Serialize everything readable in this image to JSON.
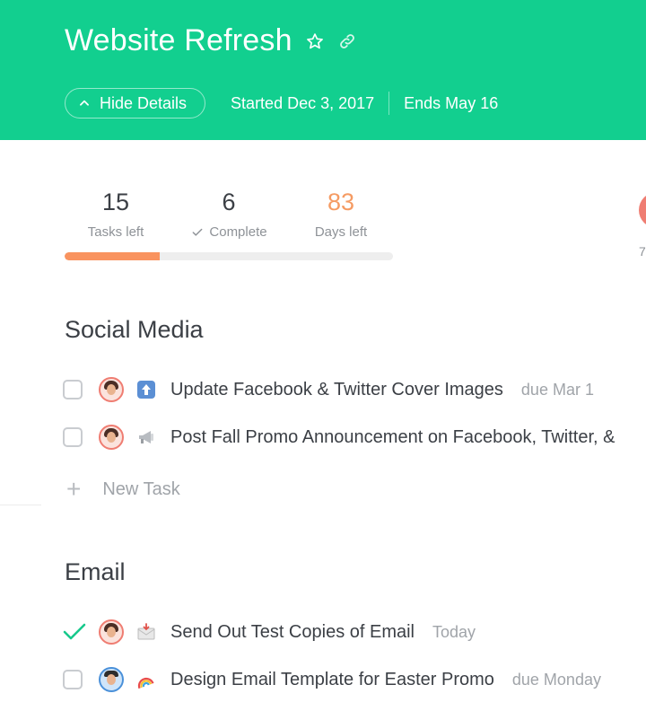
{
  "header": {
    "title": "Website Refresh",
    "hide_details_label": "Hide Details",
    "started": "Started Dec 3, 2017",
    "ends": "Ends May 16",
    "bg_color": "#12cf8f"
  },
  "stats": {
    "tasks_left": {
      "value": "15",
      "label": "Tasks left"
    },
    "complete": {
      "value": "6",
      "label": "Complete"
    },
    "days_left": {
      "value": "83",
      "label": "Days left"
    },
    "progress_fraction": 0.29,
    "progress_color": "#f9935f"
  },
  "right_partial": {
    "number": "7"
  },
  "sections": [
    {
      "title": "Social Media",
      "tasks": [
        {
          "text": "Update Facebook & Twitter Cover Images",
          "due": "due Mar 1",
          "done": false,
          "emoji": "up-arrow-icon"
        },
        {
          "text": "Post Fall Promo Announcement on Facebook, Twitter, &",
          "due": "",
          "done": false,
          "emoji": "megaphone-icon"
        }
      ],
      "new_task_label": "New Task"
    },
    {
      "title": "Email",
      "tasks": [
        {
          "text": "Send Out Test Copies of Email",
          "due": "Today",
          "done": true,
          "emoji": "envelope-icon"
        },
        {
          "text": "Design Email Template for Easter Promo",
          "due": "due Monday",
          "done": false,
          "emoji": "rainbow-icon"
        }
      ]
    }
  ]
}
